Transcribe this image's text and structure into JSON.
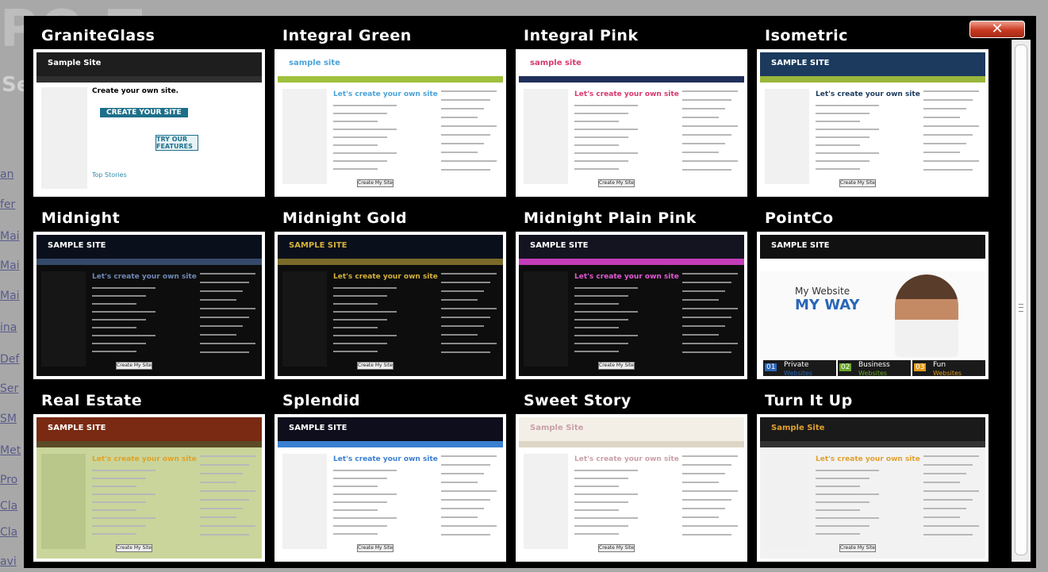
{
  "background_page": {
    "links": [
      "an",
      "fer",
      "Mai",
      "Mai",
      "Mai",
      "ina",
      "Def",
      "Ser",
      "SM",
      "Met",
      "Pro",
      "Cla",
      "Cla",
      "avi"
    ]
  },
  "modal": {
    "close_label": "✕",
    "themes": [
      {
        "name": "GraniteGlass",
        "sample": "Sample Site",
        "scheme": {
          "header": "#1e1e1e",
          "nav": "#2f2f2f",
          "body": "#ffffff",
          "accent": "#2c8aa8"
        }
      },
      {
        "name": "Integral Green",
        "sample": "sample site",
        "scheme": {
          "header": "#ffffff",
          "nav": "#9fc13c",
          "body": "#ffffff",
          "accent": "#4aa3d8"
        }
      },
      {
        "name": "Integral Pink",
        "sample": "sample site",
        "scheme": {
          "header": "#ffffff",
          "nav": "#20305a",
          "body": "#ffffff",
          "accent": "#d7396c"
        }
      },
      {
        "name": "Isometric",
        "sample": "SAMPLE SITE",
        "scheme": {
          "header": "#1b3a5e",
          "nav": "#9ab63a",
          "body": "#ffffff",
          "accent": "#1b3a5e"
        }
      },
      {
        "name": "Midnight",
        "sample": "SAMPLE SITE",
        "scheme": {
          "header": "#0a0f1c",
          "nav": "#354a6b",
          "body": "#0d0d0d",
          "accent": "#6f88b3"
        }
      },
      {
        "name": "Midnight Gold",
        "sample": "SAMPLE SITE",
        "scheme": {
          "header": "#0a0f1c",
          "nav": "#7a6a2a",
          "body": "#0d0d0d",
          "accent": "#d4b23a"
        }
      },
      {
        "name": "Midnight Plain Pink",
        "sample": "SAMPLE SITE",
        "scheme": {
          "header": "#141420",
          "nav": "#c43cb8",
          "body": "#0d0d0d",
          "accent": "#e05ad4"
        }
      },
      {
        "name": "PointCo",
        "sample": "SAMPLE SITE",
        "scheme": {
          "header": "#111111",
          "nav": "#ffffff",
          "body": "#ffffff",
          "accent": "#2a66b8"
        }
      },
      {
        "name": "Real Estate",
        "sample": "SAMPLE SITE",
        "scheme": {
          "header": "#7a2a12",
          "nav": "#5a4a26",
          "body": "#c9d59a",
          "accent": "#e0a22a"
        }
      },
      {
        "name": "Splendid",
        "sample": "SAMPLE SITE",
        "scheme": {
          "header": "#0e0e1c",
          "nav": "#3a7fd0",
          "body": "#ffffff",
          "accent": "#3a7fd0"
        }
      },
      {
        "name": "Sweet Story",
        "sample": "Sample Site",
        "scheme": {
          "header": "#f4efe6",
          "nav": "#ddd5c6",
          "body": "#ffffff",
          "accent": "#c9a0a8"
        }
      },
      {
        "name": "Turn It Up",
        "sample": "Sample Site",
        "scheme": {
          "header": "#1a1a1a",
          "nav": "#333333",
          "body": "#f2f2f2",
          "accent": "#e0a030"
        }
      }
    ],
    "pointco": {
      "headline_small": "My Website",
      "headline_big": "MY WAY",
      "tiles": [
        {
          "num": "01",
          "title": "Private",
          "sub": "Websites"
        },
        {
          "num": "02",
          "title": "Business",
          "sub": "Websites"
        },
        {
          "num": "03",
          "title": "Fun",
          "sub": "Websites"
        }
      ]
    },
    "granite": {
      "headline": "Create your own site.",
      "button": "CREATE YOUR SITE",
      "try": "TRY OUR FEATURES",
      "top": "Top Stories"
    },
    "form_heading": "Let's create your own site",
    "create_button": "Create My Site"
  }
}
